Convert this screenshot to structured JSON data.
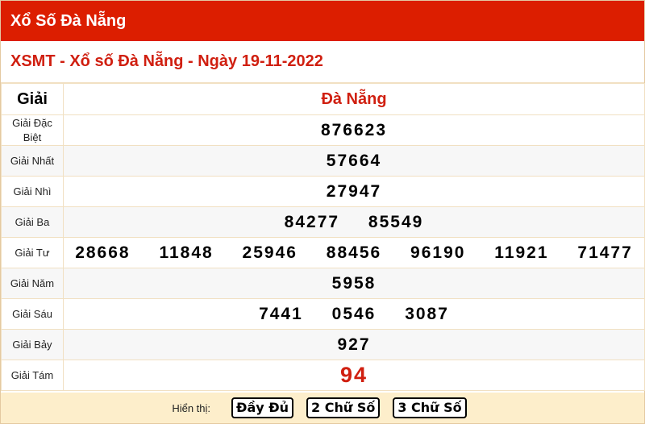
{
  "header": {
    "title": "Xổ Số Đà Nẵng"
  },
  "subheader": {
    "title": "XSMT - Xổ số Đà Nẵng - Ngày 19-11-2022"
  },
  "table": {
    "col_prize": "Giải",
    "col_province": "Đà Nẵng",
    "rows": [
      {
        "label": "Giải Đặc Biệt",
        "numbers": [
          "876623"
        ]
      },
      {
        "label": "Giải Nhất",
        "numbers": [
          "57664"
        ]
      },
      {
        "label": "Giải Nhì",
        "numbers": [
          "27947"
        ]
      },
      {
        "label": "Giải Ba",
        "numbers": [
          "84277",
          "85549"
        ]
      },
      {
        "label": "Giải Tư",
        "numbers": [
          "28668",
          "11848",
          "25946",
          "88456",
          "96190",
          "11921",
          "71477"
        ]
      },
      {
        "label": "Giải Năm",
        "numbers": [
          "5958"
        ]
      },
      {
        "label": "Giải Sáu",
        "numbers": [
          "7441",
          "0546",
          "3087"
        ]
      },
      {
        "label": "Giải Bảy",
        "numbers": [
          "927"
        ]
      },
      {
        "label": "Giải Tám",
        "numbers": [
          "94"
        ]
      }
    ]
  },
  "footer": {
    "show_label": "Hiển thị:",
    "buttons": [
      "Đầy Đủ",
      "2 Chữ Số",
      "3 Chữ Số"
    ]
  },
  "colors": {
    "header_bg": "#dc1e00",
    "accent_red": "#d01f10",
    "footer_bg": "#fdeecb",
    "border": "#f1e0c2"
  }
}
